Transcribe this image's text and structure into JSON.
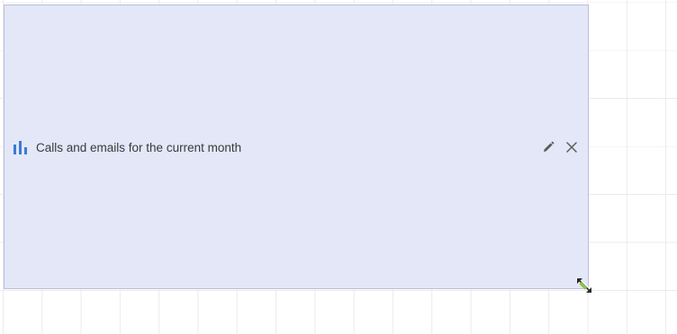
{
  "widget": {
    "title": "Calls and emails for the current month",
    "icon": "bar-chart-icon",
    "accent_color": "#3b7bd4",
    "background_color": "#e3e7f8",
    "actions": [
      {
        "name": "edit",
        "icon": "pencil-icon"
      },
      {
        "name": "close",
        "icon": "close-icon"
      }
    ]
  },
  "resize_handle": {
    "icon": "resize-arrows-icon"
  }
}
